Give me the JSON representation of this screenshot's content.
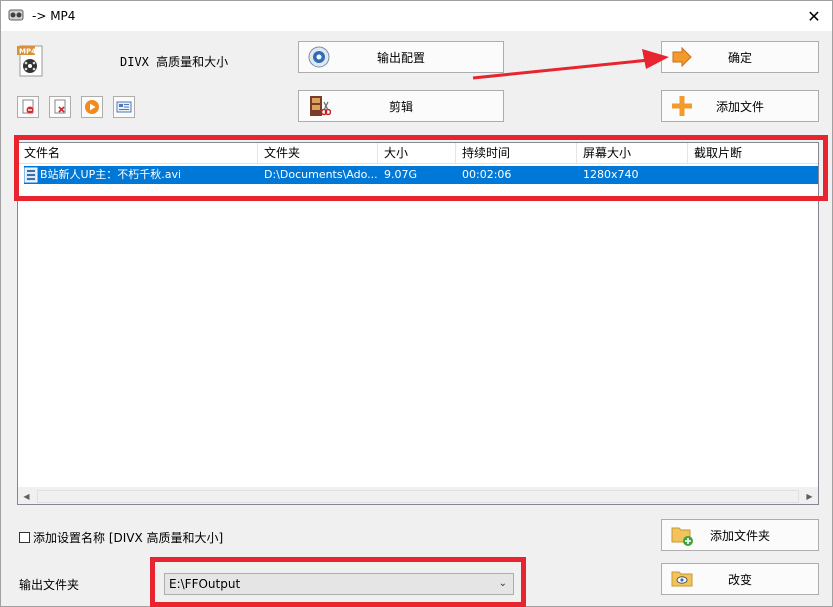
{
  "window": {
    "title": "-> MP4"
  },
  "format": {
    "label": "DIVX 高质量和大小",
    "icon_text": "MP4"
  },
  "buttons": {
    "output_config": "输出配置",
    "ok": "确定",
    "edit": "剪辑",
    "add_file": "添加文件",
    "add_folder": "添加文件夹",
    "change": "改变"
  },
  "table": {
    "columns": [
      "文件名",
      "文件夹",
      "大小",
      "持续时间",
      "屏幕大小",
      "截取片断"
    ],
    "rows": [
      {
        "name": "B站新人UP主：不朽千秋.avi",
        "folder": "D:\\Documents\\Ado...",
        "size": "9.07G",
        "duration": "00:02:06",
        "screen": "1280x740",
        "clip": ""
      }
    ]
  },
  "options": {
    "add_setting_name": "添加设置名称 [DIVX 高质量和大小]",
    "add_setting_checked": false
  },
  "output": {
    "label": "输出文件夹",
    "folder": "E:\\FFOutput"
  },
  "colors": {
    "highlight": "#e8242f",
    "selection": "#0078d7"
  }
}
